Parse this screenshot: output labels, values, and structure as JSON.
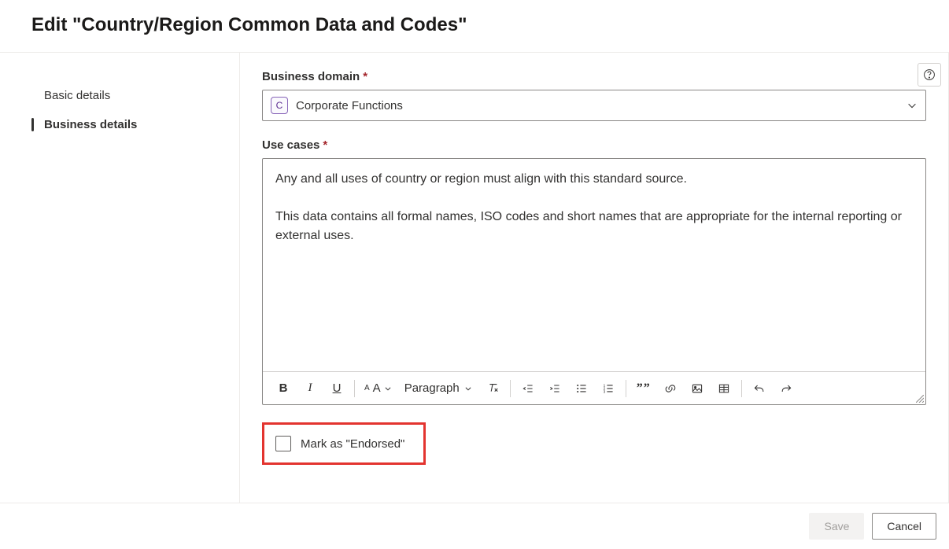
{
  "header": {
    "title": "Edit \"Country/Region Common Data and Codes\""
  },
  "sidebar": {
    "items": [
      {
        "label": "Basic details",
        "active": false
      },
      {
        "label": "Business details",
        "active": true
      }
    ]
  },
  "form": {
    "business_domain": {
      "label": "Business domain",
      "required_marker": "*",
      "badge_letter": "C",
      "value": "Corporate Functions"
    },
    "use_cases": {
      "label": "Use cases",
      "required_marker": "*",
      "content": "Any and all uses of country or region must align with this standard source.\n\nThis data contains all formal names, ISO codes and short names that are appropriate for the internal reporting or external uses."
    },
    "toolbar": {
      "paragraph_label": "Paragraph"
    },
    "endorsed": {
      "label": "Mark as \"Endorsed\"",
      "checked": false
    }
  },
  "footer": {
    "save_label": "Save",
    "cancel_label": "Cancel"
  },
  "help": {
    "tooltip": "Help"
  }
}
